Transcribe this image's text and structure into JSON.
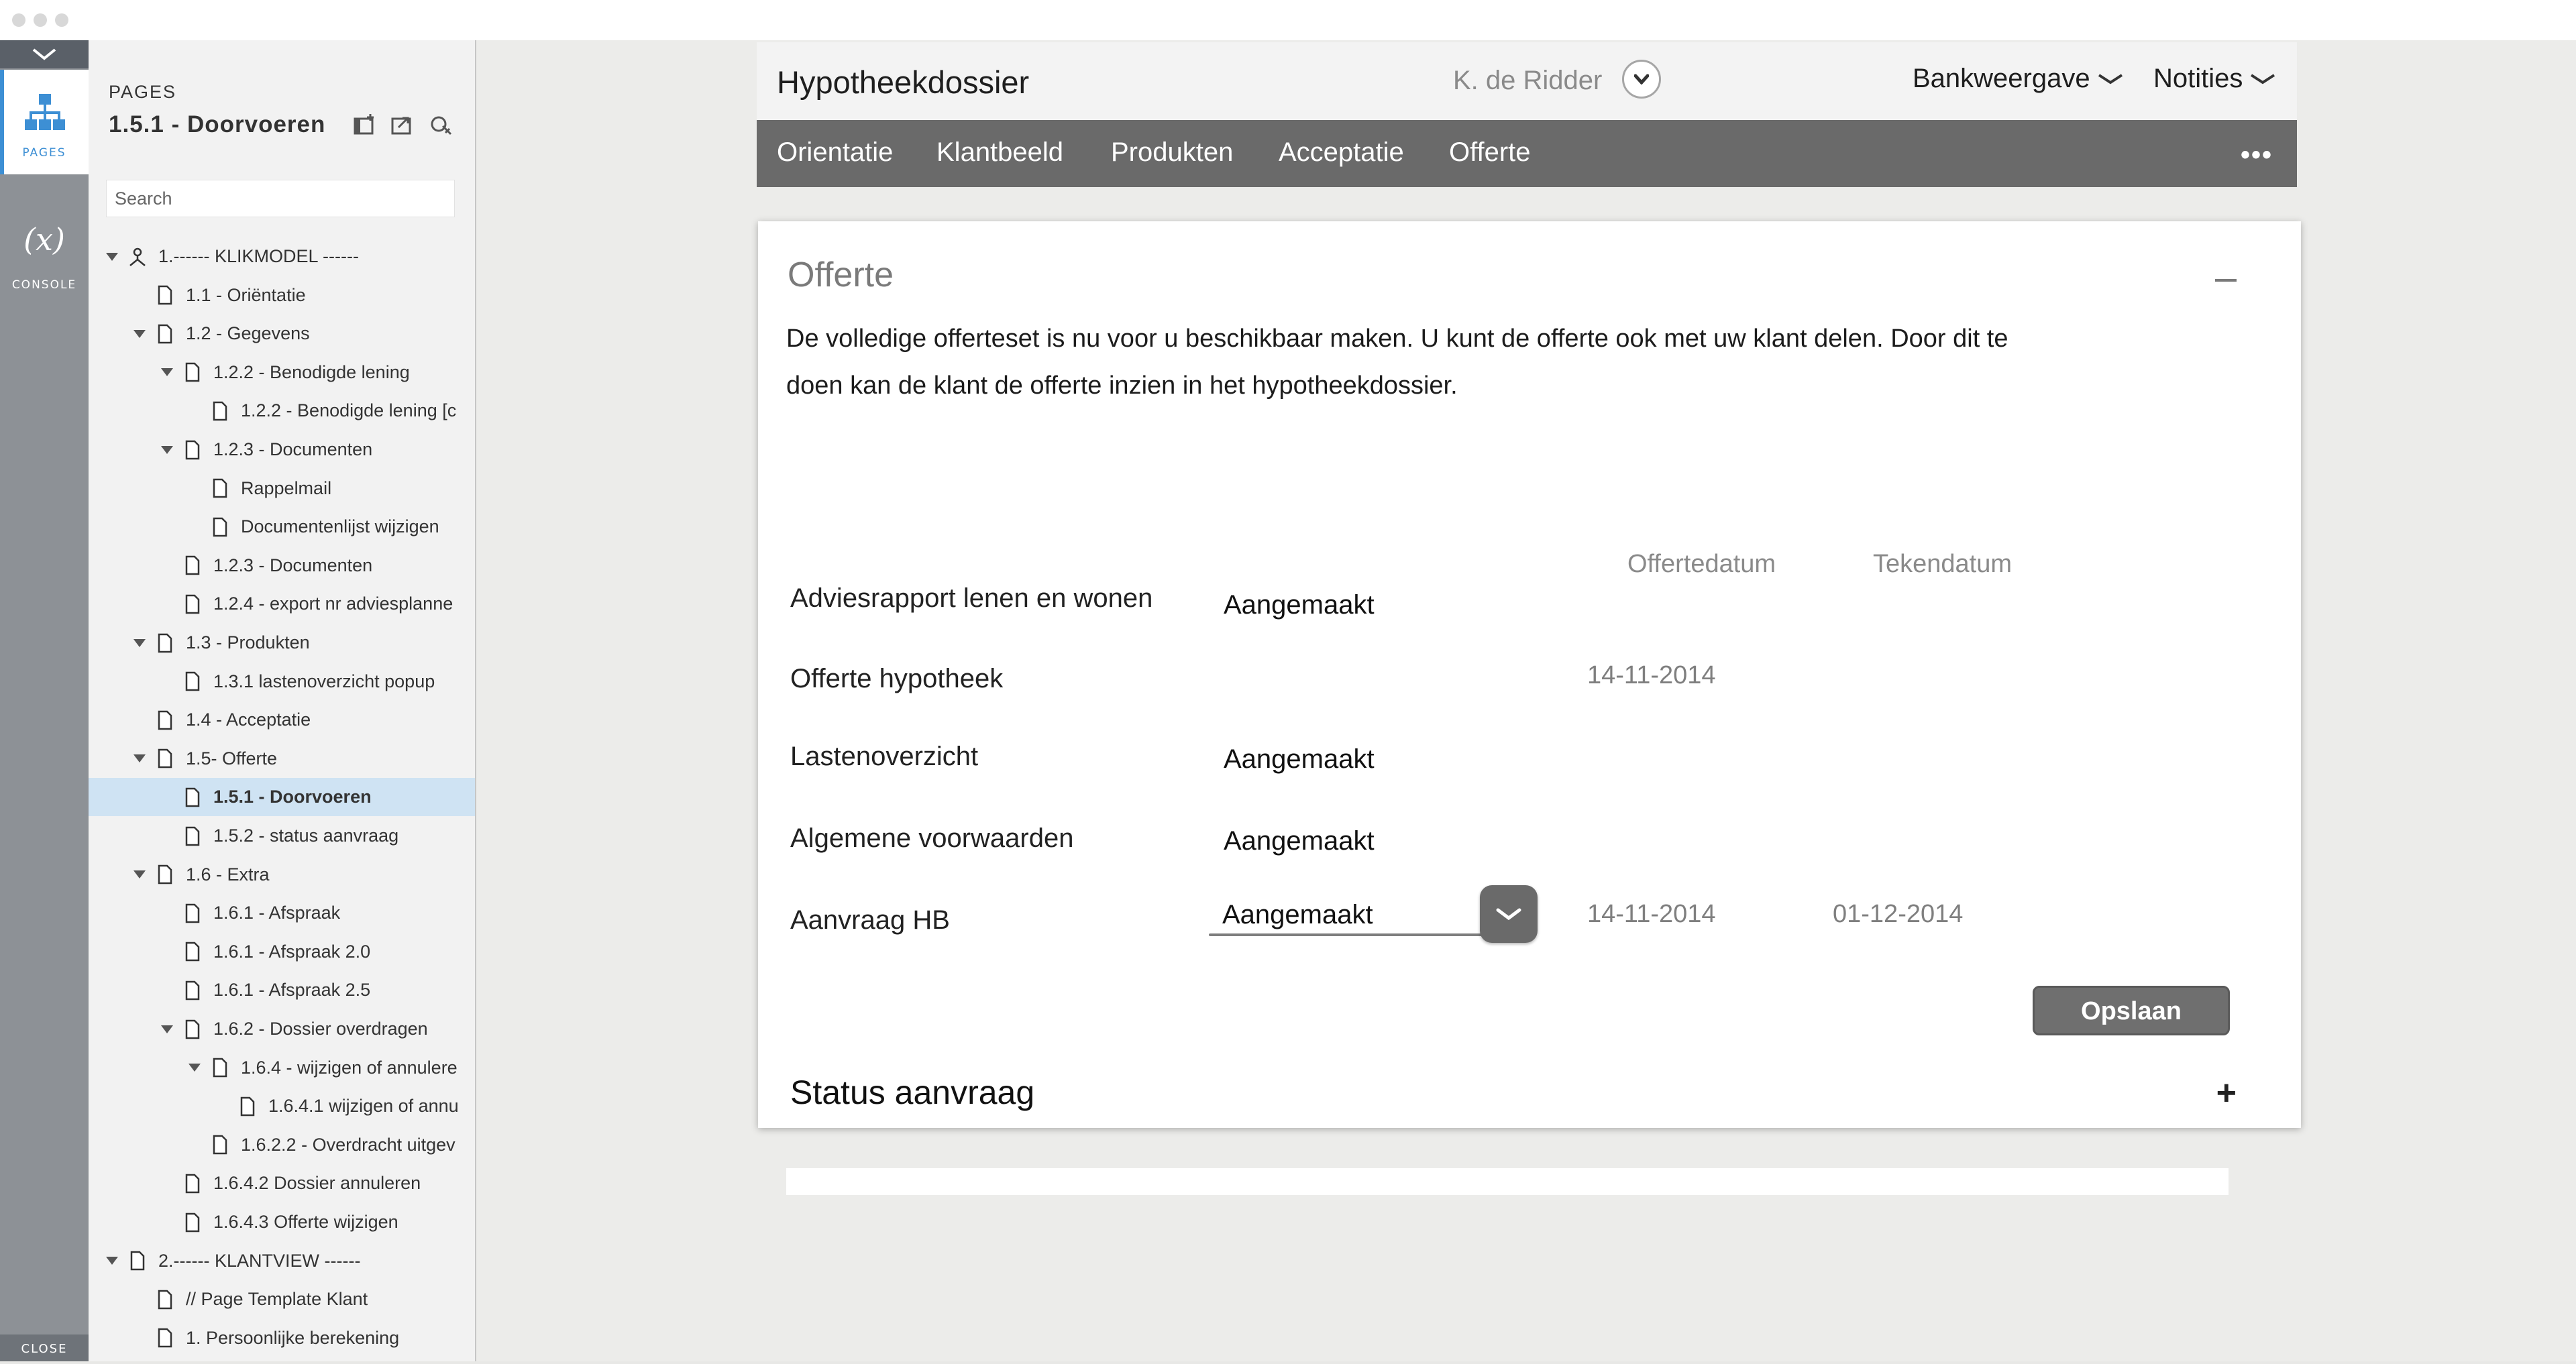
{
  "sidebar": {
    "rail": {
      "pages_label": "PAGES",
      "console_label": "CONSOLE",
      "close_label": "CLOSE"
    },
    "heading": "PAGES",
    "current_page": "1.5.1 - Doorvoeren",
    "search_placeholder": "Search",
    "tree": [
      {
        "label": "1.------ KLIKMODEL ------",
        "depth": 0,
        "toggle": "open",
        "icon": "folder-home-icon"
      },
      {
        "label": "1.1 - Oriëntatie",
        "depth": 1,
        "toggle": "none",
        "icon": "page-icon"
      },
      {
        "label": "1.2 - Gegevens",
        "depth": 1,
        "toggle": "open",
        "icon": "page-icon"
      },
      {
        "label": "1.2.2 - Benodigde lening",
        "depth": 2,
        "toggle": "open",
        "icon": "page-icon"
      },
      {
        "label": "1.2.2 - Benodigde lening [c",
        "depth": 3,
        "toggle": "none",
        "icon": "page-icon"
      },
      {
        "label": "1.2.3 - Documenten",
        "depth": 2,
        "toggle": "open",
        "icon": "page-icon"
      },
      {
        "label": "Rappelmail",
        "depth": 3,
        "toggle": "none",
        "icon": "page-icon"
      },
      {
        "label": "Documentenlijst wijzigen",
        "depth": 3,
        "toggle": "none",
        "icon": "page-icon"
      },
      {
        "label": "1.2.3 - Documenten",
        "depth": 2,
        "toggle": "none",
        "icon": "page-icon"
      },
      {
        "label": "1.2.4 - export nr adviesplanne",
        "depth": 2,
        "toggle": "none",
        "icon": "page-icon"
      },
      {
        "label": "1.3 - Produkten",
        "depth": 1,
        "toggle": "open",
        "icon": "page-icon"
      },
      {
        "label": "1.3.1 lastenoverzicht popup",
        "depth": 2,
        "toggle": "none",
        "icon": "page-icon"
      },
      {
        "label": "1.4 - Acceptatie",
        "depth": 1,
        "toggle": "none",
        "icon": "page-icon"
      },
      {
        "label": "1.5- Offerte",
        "depth": 1,
        "toggle": "open",
        "icon": "page-icon"
      },
      {
        "label": "1.5.1 - Doorvoeren",
        "depth": 2,
        "toggle": "none",
        "icon": "page-icon",
        "selected": true
      },
      {
        "label": "1.5.2 - status aanvraag",
        "depth": 2,
        "toggle": "none",
        "icon": "page-icon"
      },
      {
        "label": "1.6 - Extra",
        "depth": 1,
        "toggle": "open",
        "icon": "page-icon"
      },
      {
        "label": "1.6.1 - Afspraak",
        "depth": 2,
        "toggle": "none",
        "icon": "page-icon"
      },
      {
        "label": "1.6.1 - Afspraak 2.0",
        "depth": 2,
        "toggle": "none",
        "icon": "page-icon"
      },
      {
        "label": "1.6.1 - Afspraak 2.5",
        "depth": 2,
        "toggle": "none",
        "icon": "page-icon"
      },
      {
        "label": "1.6.2 - Dossier overdragen",
        "depth": 2,
        "toggle": "open",
        "icon": "page-icon"
      },
      {
        "label": "1.6.4 - wijzigen of annulere",
        "depth": 3,
        "toggle": "open",
        "icon": "page-icon"
      },
      {
        "label": "1.6.4.1 wijzigen of annu",
        "depth": 4,
        "toggle": "none",
        "icon": "page-icon"
      },
      {
        "label": "1.6.2.2 - Overdracht uitgev",
        "depth": 3,
        "toggle": "none",
        "icon": "page-icon"
      },
      {
        "label": "1.6.4.2 Dossier annuleren",
        "depth": 2,
        "toggle": "none",
        "icon": "page-icon"
      },
      {
        "label": "1.6.4.3 Offerte wijzigen",
        "depth": 2,
        "toggle": "none",
        "icon": "page-icon"
      },
      {
        "label": "2.------ KLANTVIEW ------",
        "depth": 0,
        "toggle": "open",
        "icon": "page-icon"
      },
      {
        "label": "// Page Template Klant",
        "depth": 1,
        "toggle": "none",
        "icon": "page-icon"
      },
      {
        "label": "1. Persoonlijke berekening",
        "depth": 1,
        "toggle": "none",
        "icon": "page-icon"
      }
    ]
  },
  "header": {
    "title": "Hypotheekdossier",
    "user": "K. de Ridder",
    "menu_bank": "Bankweergave",
    "menu_notes": "Notities"
  },
  "nav": {
    "tabs": [
      "Orientatie",
      "Klantbeeld",
      "Produkten",
      "Acceptatie",
      "Offerte"
    ],
    "more": "•••"
  },
  "offerte": {
    "title": "Offerte",
    "intro": "De volledige offerteset is nu voor u beschikbaar maken. U kunt de offerte ook met uw klant delen. Door dit te doen kan de klant de offerte inzien in het hypotheekdossier.",
    "col_offertedatum": "Offertedatum",
    "col_tekendatum": "Tekendatum",
    "rows": [
      {
        "label": "Adviesrapport lenen en wonen",
        "status": "Aangemaakt",
        "offertedatum": "",
        "tekendatum": ""
      },
      {
        "label": "Offerte hypotheek",
        "status": "",
        "offertedatum": "14-11-2014",
        "tekendatum": ""
      },
      {
        "label": "Lastenoverzicht",
        "status": "Aangemaakt",
        "offertedatum": "",
        "tekendatum": ""
      },
      {
        "label": "Algemene voorwaarden",
        "status": "Aangemaakt",
        "offertedatum": "",
        "tekendatum": ""
      },
      {
        "label": "Aanvraag HB",
        "status": "Aangemaakt",
        "offertedatum": "14-11-2014",
        "tekendatum": "01-12-2014"
      }
    ],
    "save_label": "Opslaan"
  },
  "status_section": {
    "title": "Status aanvraag",
    "expand": "+"
  },
  "colors": {
    "accent": "#3d8fd4",
    "nav_bar": "#6a6a6a",
    "selected_row": "#cfe3f3"
  }
}
